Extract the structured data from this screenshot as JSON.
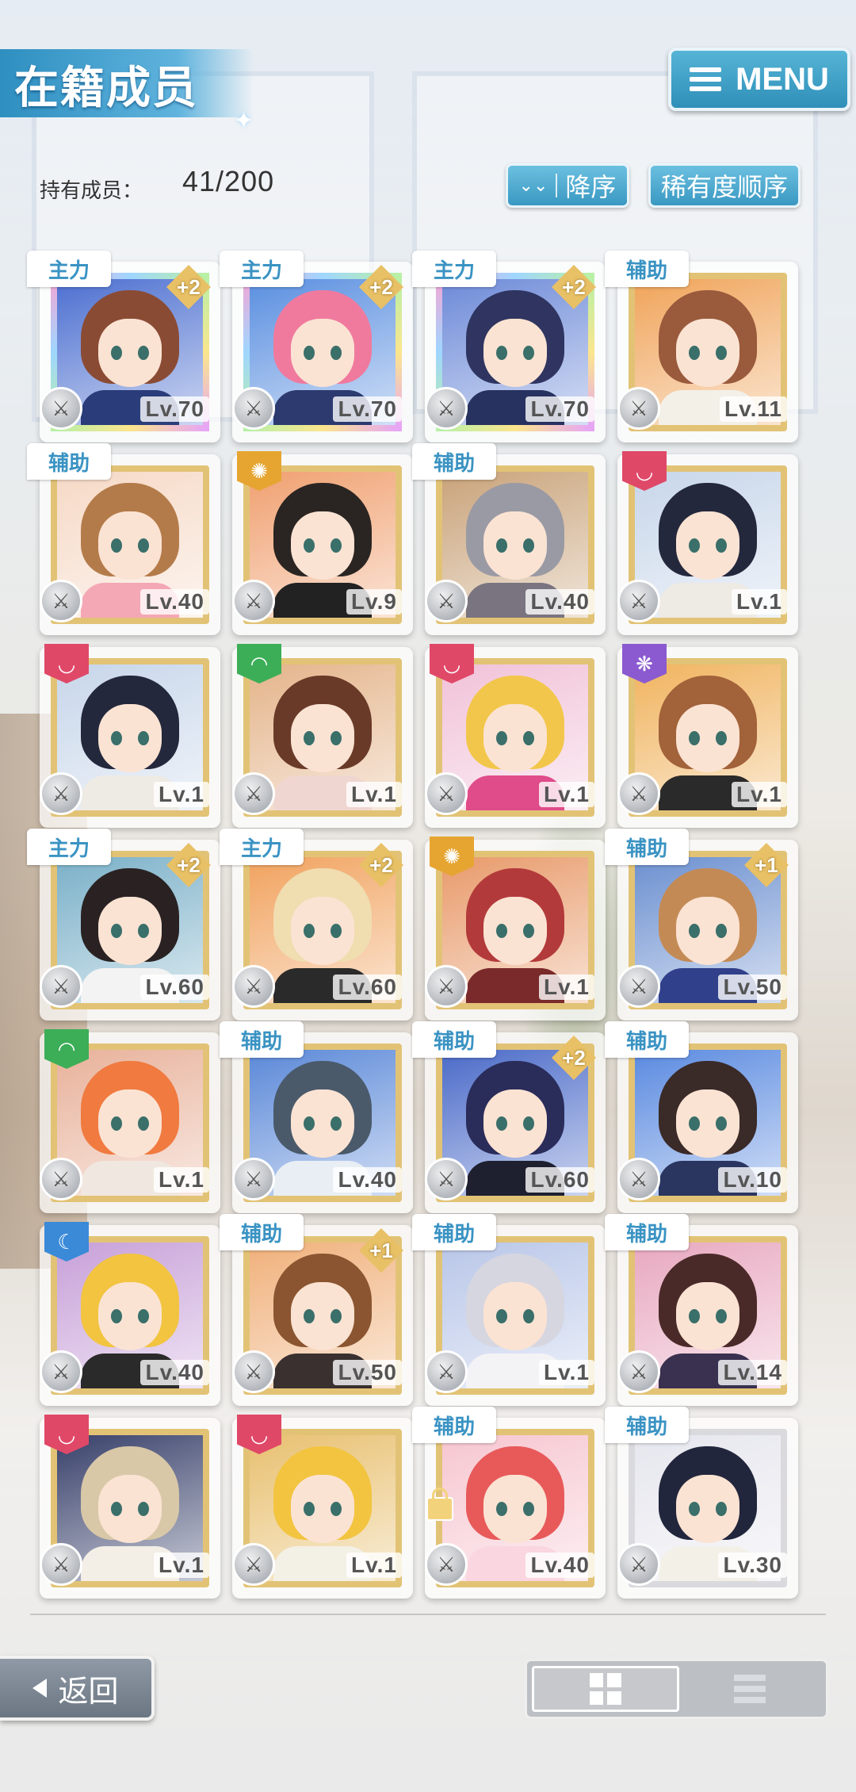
{
  "header": {
    "title": "在籍成员",
    "menu_label": "MENU"
  },
  "stats": {
    "count_label": "持有成员：",
    "count_value": "41/200"
  },
  "sort": {
    "order_label": "降序",
    "type_label": "稀有度顺序"
  },
  "members": [
    {
      "role": "主力",
      "plus": "+2",
      "level": "Lv.70",
      "frame": "rainbow",
      "hair": "#8a4b34",
      "bg": "#4c6fd0",
      "outfit": "#2a3d7a",
      "attr": "#e04868"
    },
    {
      "role": "主力",
      "plus": "+2",
      "level": "Lv.70",
      "frame": "rainbow",
      "hair": "#f07a9e",
      "bg": "#5a8fe0",
      "outfit": "#2c3a70",
      "attr": "#e04868"
    },
    {
      "role": "主力",
      "plus": "+2",
      "level": "Lv.70",
      "frame": "rainbow",
      "hair": "#2f3560",
      "bg": "#6d8ad8",
      "outfit": "#283260",
      "attr": "#e6a531"
    },
    {
      "role": "辅助",
      "plus": "",
      "level": "Lv.11",
      "frame": "gold",
      "hair": "#9a5a3c",
      "bg": "#f0a45a",
      "outfit": "#f3f0e8",
      "attr": "#3cae57"
    },
    {
      "role": "辅助",
      "plus": "",
      "level": "Lv.40",
      "frame": "gold",
      "hair": "#b47b4a",
      "bg": "#f6d9c6",
      "outfit": "#f4a7b5",
      "attr": "#3a8ad8"
    },
    {
      "role": "",
      "plus": "",
      "level": "Lv.9",
      "frame": "gold",
      "hair": "#2a2522",
      "bg": "#f0a070",
      "outfit": "#222",
      "attr": "#e6a531"
    },
    {
      "role": "辅助",
      "plus": "",
      "level": "Lv.40",
      "frame": "gold",
      "hair": "#9a9aa4",
      "bg": "#c9a37a",
      "outfit": "#7a7480",
      "attr": "#3cae57"
    },
    {
      "role": "",
      "plus": "",
      "level": "Lv.1",
      "frame": "gold",
      "hair": "#24283c",
      "bg": "#c7d6ea",
      "outfit": "#eeeae4",
      "attr": "#e04868"
    },
    {
      "role": "",
      "plus": "",
      "level": "Lv.1",
      "frame": "gold",
      "hair": "#24283c",
      "bg": "#c7d6ea",
      "outfit": "#eeeae4",
      "attr": "#e04868"
    },
    {
      "role": "",
      "plus": "",
      "level": "Lv.1",
      "frame": "gold",
      "hair": "#6a3a28",
      "bg": "#e4b48a",
      "outfit": "#f0d6d0",
      "attr": "#3cae57"
    },
    {
      "role": "",
      "plus": "",
      "level": "Lv.1",
      "frame": "gold",
      "hair": "#f2c64a",
      "bg": "#f1c2d8",
      "outfit": "#e04b8a",
      "attr": "#e04868"
    },
    {
      "role": "",
      "plus": "",
      "level": "Lv.1",
      "frame": "gold",
      "hair": "#a2623a",
      "bg": "#f0b35e",
      "outfit": "#2a2a2a",
      "attr": "#8b5ad0"
    },
    {
      "role": "主力",
      "plus": "+2",
      "level": "Lv.60",
      "frame": "gold",
      "hair": "#2a2222",
      "bg": "#7ab0c8",
      "outfit": "#f3f3f3",
      "attr": "#3cae57"
    },
    {
      "role": "主力",
      "plus": "+2",
      "level": "Lv.60",
      "frame": "gold",
      "hair": "#f0ddb0",
      "bg": "#f1a25e",
      "outfit": "#2a2a2a",
      "attr": "#e6a531"
    },
    {
      "role": "",
      "plus": "",
      "level": "Lv.1",
      "frame": "gold",
      "hair": "#b33a3a",
      "bg": "#e89a6a",
      "outfit": "#7a2a2a",
      "attr": "#e6a531"
    },
    {
      "role": "辅助",
      "plus": "+1",
      "level": "Lv.50",
      "frame": "gold",
      "hair": "#c48a55",
      "bg": "#6c90d0",
      "outfit": "#30408a",
      "attr": "#e04868"
    },
    {
      "role": "",
      "plus": "",
      "level": "Lv.1",
      "frame": "gold",
      "hair": "#f07a40",
      "bg": "#e8b19a",
      "outfit": "#f0e8e0",
      "attr": "#3cae57"
    },
    {
      "role": "辅助",
      "plus": "",
      "level": "Lv.40",
      "frame": "gold",
      "hair": "#4a5a6a",
      "bg": "#5a88d8",
      "outfit": "#e8eef4",
      "attr": "#3a8ad8"
    },
    {
      "role": "辅助",
      "plus": "+2",
      "level": "Lv.60",
      "frame": "gold",
      "hair": "#2a2c5a",
      "bg": "#4a6ac8",
      "outfit": "#1e2030",
      "attr": "#3a8ad8"
    },
    {
      "role": "辅助",
      "plus": "",
      "level": "Lv.10",
      "frame": "gold",
      "hair": "#3a2a28",
      "bg": "#5a8ae0",
      "outfit": "#2a3560",
      "attr": "#e04868"
    },
    {
      "role": "",
      "plus": "",
      "level": "Lv.40",
      "frame": "gold",
      "hair": "#f2c440",
      "bg": "#c7a0d8",
      "outfit": "#2a2a2a",
      "attr": "#3a8ad8"
    },
    {
      "role": "辅助",
      "plus": "+1",
      "level": "Lv.50",
      "frame": "gold",
      "hair": "#8a5530",
      "bg": "#f0b07a",
      "outfit": "#3a3030",
      "attr": "#3cae57"
    },
    {
      "role": "辅助",
      "plus": "",
      "level": "Lv.1",
      "frame": "gold",
      "hair": "#d6d6e0",
      "bg": "#b8c6e8",
      "outfit": "#f3f3f6",
      "attr": "#8b5ad0"
    },
    {
      "role": "辅助",
      "plus": "",
      "level": "Lv.14",
      "frame": "gold",
      "hair": "#4a2a28",
      "bg": "#e8a8c0",
      "outfit": "#3a3050",
      "attr": "#8b5ad0"
    },
    {
      "role": "",
      "plus": "",
      "level": "Lv.1",
      "frame": "gold",
      "hair": "#d8c8a8",
      "bg": "#38406a",
      "outfit": "#f3eee6",
      "attr": "#e04868"
    },
    {
      "role": "",
      "plus": "",
      "level": "Lv.1",
      "frame": "gold",
      "hair": "#f2c440",
      "bg": "#e8c070",
      "outfit": "#f3f0e6",
      "attr": "#e04868"
    },
    {
      "role": "辅助",
      "plus": "",
      "level": "Lv.40",
      "frame": "gold",
      "hair": "#e85a5a",
      "bg": "#f6c6d0",
      "outfit": "#f9d6e0",
      "attr": "#3cae57",
      "locked": true
    },
    {
      "role": "辅助",
      "plus": "",
      "level": "Lv.30",
      "frame": "silver",
      "hair": "#22263c",
      "bg": "#e6e6ee",
      "outfit": "#f3f0e8",
      "attr": "#8b5ad0"
    }
  ],
  "footer": {
    "back_label": "返回"
  },
  "icons": {
    "menu": "hamburger-icon",
    "sort_order": "double-chevron-down-icon",
    "weapon": "weapon-icon",
    "grid_view": "grid-view-icon",
    "list_view": "list-view-icon",
    "back": "back-arrow-icon"
  }
}
